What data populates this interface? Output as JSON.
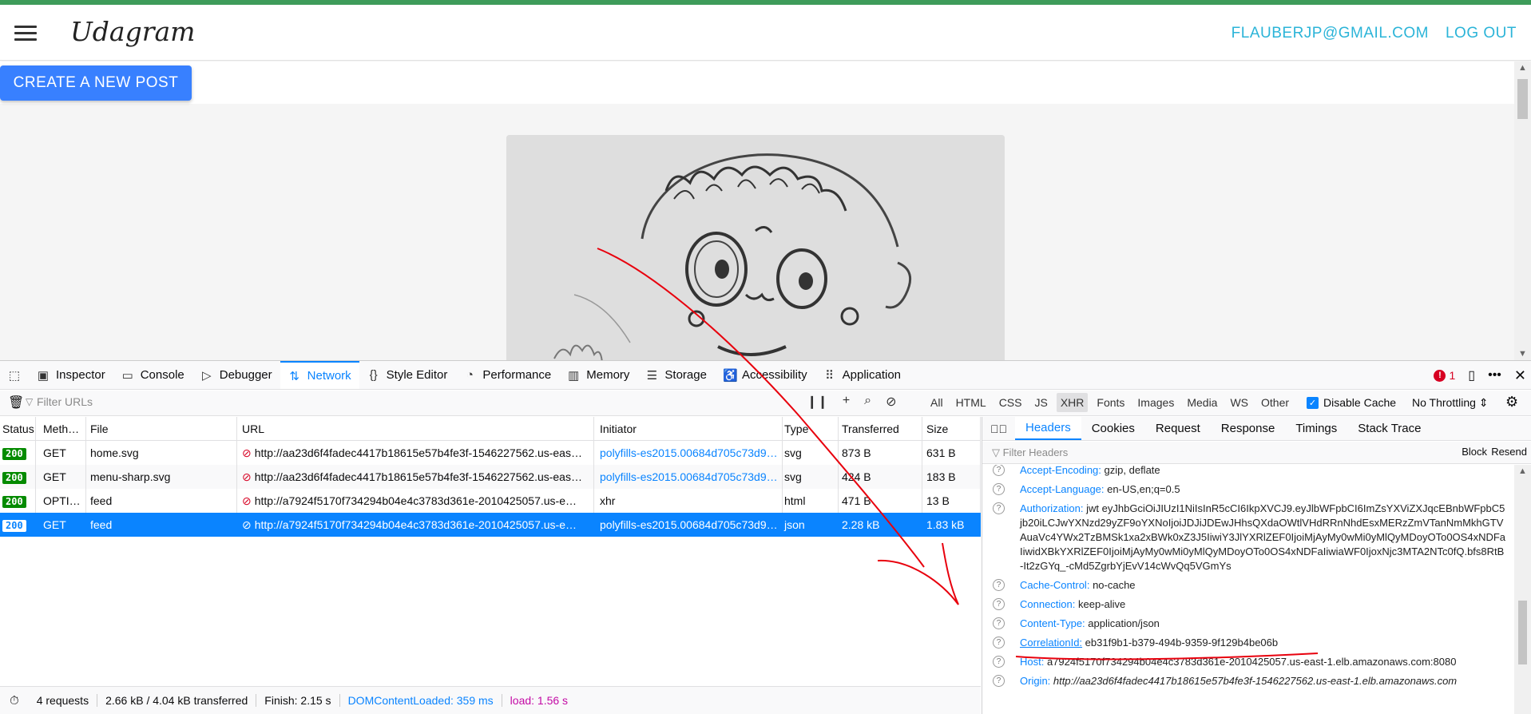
{
  "app": {
    "brand": "Udagram",
    "user_email": "FLAUBERJP@GMAIL.COM",
    "logout_label": "LOG OUT",
    "create_post_label": "CREATE A NEW POST"
  },
  "devtools": {
    "tabs": [
      {
        "label": "Inspector",
        "icon": "inspector-icon"
      },
      {
        "label": "Console",
        "icon": "console-icon"
      },
      {
        "label": "Debugger",
        "icon": "debugger-icon"
      },
      {
        "label": "Network",
        "icon": "network-icon"
      },
      {
        "label": "Style Editor",
        "icon": "style-editor-icon"
      },
      {
        "label": "Performance",
        "icon": "performance-icon"
      },
      {
        "label": "Memory",
        "icon": "memory-icon"
      },
      {
        "label": "Storage",
        "icon": "storage-icon"
      },
      {
        "label": "Accessibility",
        "icon": "accessibility-icon"
      },
      {
        "label": "Application",
        "icon": "application-icon"
      }
    ],
    "error_count": "1",
    "filter_urls_placeholder": "Filter URLs",
    "type_filters": [
      "All",
      "HTML",
      "CSS",
      "JS",
      "XHR",
      "Fonts",
      "Images",
      "Media",
      "WS",
      "Other"
    ],
    "disable_cache_label": "Disable Cache",
    "throttling_label": "No Throttling",
    "columns": [
      "Status",
      "Meth…",
      "File",
      "URL",
      "Initiator",
      "Type",
      "Transferred",
      "Size"
    ],
    "requests": [
      {
        "status": "200",
        "method": "GET",
        "file": "home.svg",
        "url": "http://aa23d6f4fadec4417b18615e57b4fe3f-1546227562.us-eas…",
        "initiator": "polyfills-es2015.00684d705c73d9…",
        "type": "svg",
        "transferred": "873 B",
        "size": "631 B"
      },
      {
        "status": "200",
        "method": "GET",
        "file": "menu-sharp.svg",
        "url": "http://aa23d6f4fadec4417b18615e57b4fe3f-1546227562.us-eas…",
        "initiator": "polyfills-es2015.00684d705c73d9…",
        "type": "svg",
        "transferred": "424 B",
        "size": "183 B"
      },
      {
        "status": "200",
        "method": "OPTI…",
        "file": "feed",
        "url": "http://a7924f5170f734294b04e4c3783d361e-2010425057.us-e…",
        "initiator": "xhr",
        "type": "html",
        "transferred": "471 B",
        "size": "13 B"
      },
      {
        "status": "200",
        "method": "GET",
        "file": "feed",
        "url": "http://a7924f5170f734294b04e4c3783d361e-2010425057.us-e…",
        "initiator": "polyfills-es2015.00684d705c73d9…",
        "type": "json",
        "transferred": "2.28 kB",
        "size": "1.83 kB"
      }
    ],
    "status_bar": {
      "requests": "4 requests",
      "transferred": "2.66 kB / 4.04 kB transferred",
      "finish": "Finish: 2.15 s",
      "dom_loaded": "DOMContentLoaded: 359 ms",
      "load": "load: 1.56 s"
    },
    "side_tabs": [
      "Headers",
      "Cookies",
      "Request",
      "Response",
      "Timings",
      "Stack Trace"
    ],
    "filter_headers_placeholder": "Filter Headers",
    "block_label": "Block",
    "resend_label": "Resend",
    "headers": [
      {
        "key": "Accept-Encoding:",
        "value": "gzip, deflate"
      },
      {
        "key": "Accept-Language:",
        "value": "en-US,en;q=0.5"
      },
      {
        "key": "Authorization:",
        "value": "jwt eyJhbGciOiJIUzI1NiIsInR5cCI6IkpXVCJ9.eyJlbWFpbCI6ImZsYXViZXJqcEBnbWFpbC5jb20iLCJwYXNzd29yZF9oYXNoIjoiJDJiJDEwJHhsQXdaOWtlVHdRRnNhdEsxMERzZmVTanNmMkhGTVAuaVc4YWx2TzBMSk1xa2xBWk0xZ3J5IiwiY3JlYXRlZEF0IjoiMjAyMy0wMi0yMlQyMDoyOTo0OS4xNDFaIiwidXBkYXRlZEF0IjoiMjAyMy0wMi0yMlQyMDoyOTo0OS4xNDFaIiwiaWF0IjoxNjc3MTA2NTc0fQ.bfs8RtB-It2zGYq_-cMd5ZgrbYjEvV14cWvQq5VGmYs"
      },
      {
        "key": "Cache-Control:",
        "value": "no-cache"
      },
      {
        "key": "Connection:",
        "value": "keep-alive"
      },
      {
        "key": "Content-Type:",
        "value": "application/json"
      },
      {
        "key": "CorrelationId:",
        "value": "eb31f9b1-b379-494b-9359-9f129b4be06b"
      },
      {
        "key": "Host:",
        "value": "a7924f5170f734294b04e4c3783d361e-2010425057.us-east-1.elb.amazonaws.com:8080"
      },
      {
        "key": "Origin:",
        "value": "http://aa23d6f4fadec4417b18615e57b4fe3f-1546227562.us-east-1.elb.amazonaws.com"
      }
    ]
  },
  "colors": {
    "accent": "#0a84ff",
    "annotation": "#e8000d",
    "status_ok": "#058b00",
    "app_button": "#3880ff",
    "app_link": "#2bb4d8"
  }
}
